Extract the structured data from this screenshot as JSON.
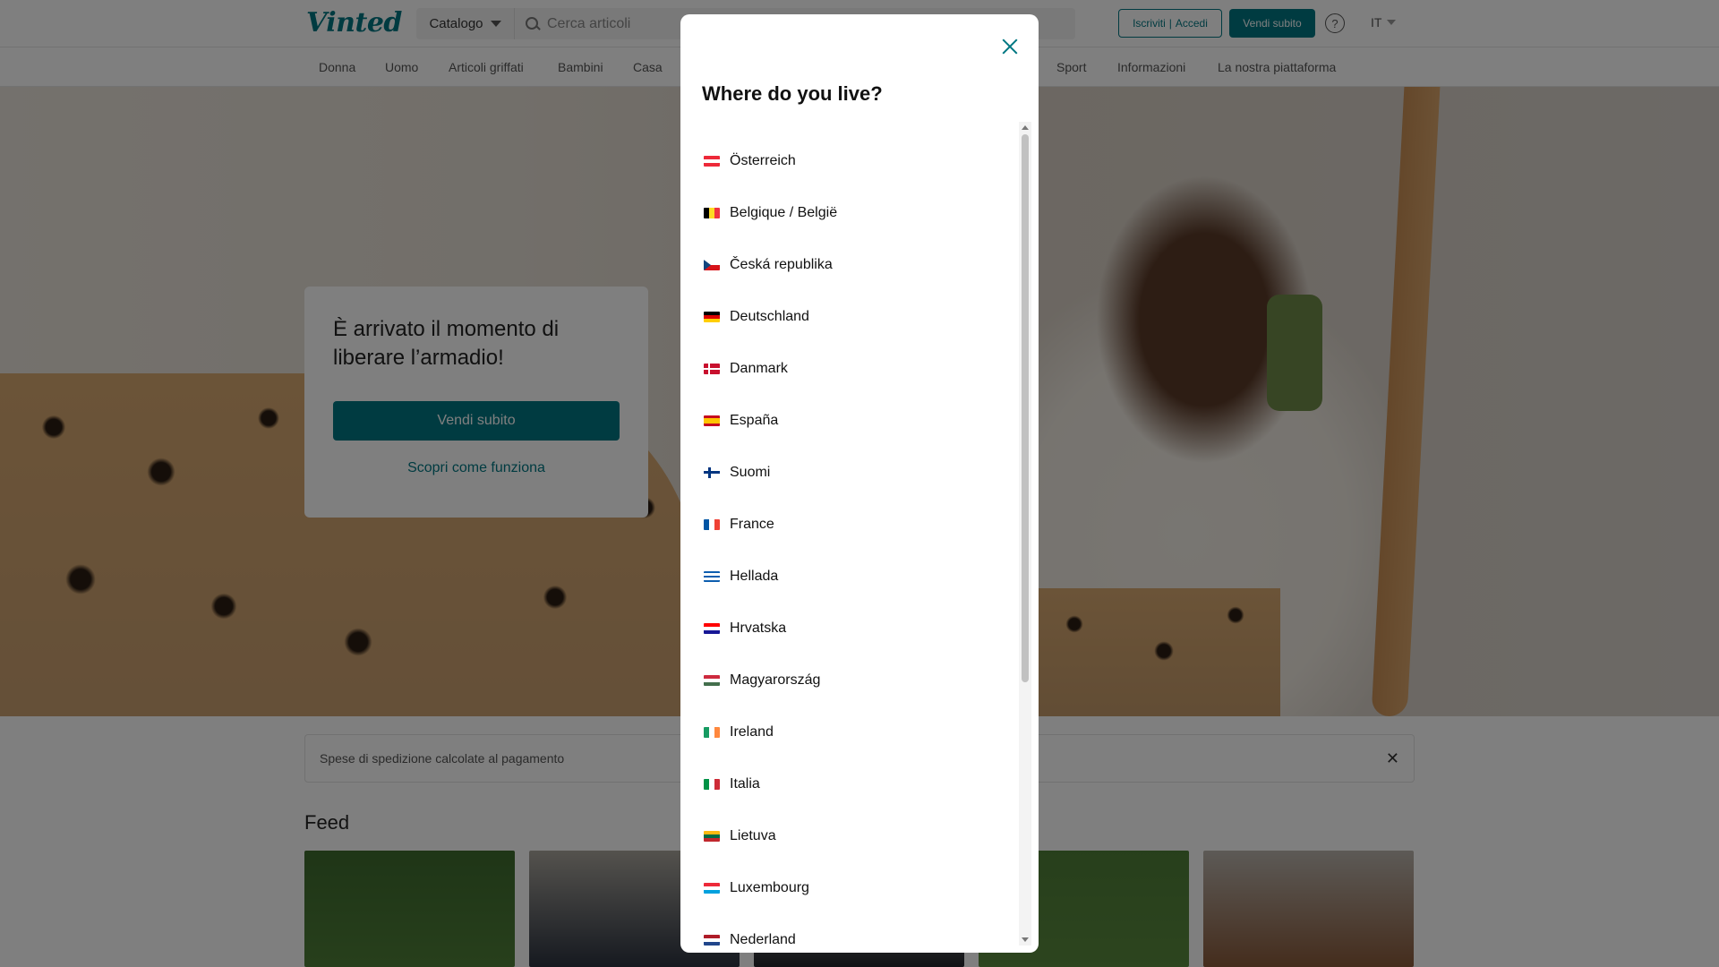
{
  "header": {
    "logo": "Vinted",
    "catalog_label": "Catalogo",
    "search_placeholder": "Cerca articoli",
    "signup_label": "Iscriviti",
    "login_label": "Accedi",
    "sell_label": "Vendi subito",
    "help_label": "?",
    "language": "IT"
  },
  "nav": {
    "items": [
      "Donna",
      "Uomo",
      "Articoli griffati",
      "Bambini",
      "Casa",
      "Sport",
      "Informazioni",
      "La nostra piattaforma"
    ]
  },
  "hero": {
    "title": "È arrivato il momento di liberare l’armadio!",
    "sell_button": "Vendi subito",
    "how_link": "Scopri come funziona"
  },
  "shipping_banner": {
    "text": "Spese di spedizione calcolate al pagamento"
  },
  "feed": {
    "title": "Feed"
  },
  "modal": {
    "title": "Where do you live?",
    "countries": [
      {
        "name": "Österreich",
        "flag": "austria-flag"
      },
      {
        "name": "Belgique / België",
        "flag": "belgium-flag"
      },
      {
        "name": "Česká republika",
        "flag": "czech-flag"
      },
      {
        "name": "Deutschland",
        "flag": "germany-flag"
      },
      {
        "name": "Danmark",
        "flag": "denmark-flag"
      },
      {
        "name": "España",
        "flag": "spain-flag"
      },
      {
        "name": "Suomi",
        "flag": "finland-flag"
      },
      {
        "name": "France",
        "flag": "france-flag"
      },
      {
        "name": "Hellada",
        "flag": "greece-flag"
      },
      {
        "name": "Hrvatska",
        "flag": "croatia-flag"
      },
      {
        "name": "Magyarország",
        "flag": "hungary-flag"
      },
      {
        "name": "Ireland",
        "flag": "ireland-flag"
      },
      {
        "name": "Italia",
        "flag": "italy-flag"
      },
      {
        "name": "Lietuva",
        "flag": "lithuania-flag"
      },
      {
        "name": "Luxembourg",
        "flag": "luxembourg-flag"
      },
      {
        "name": "Nederland",
        "flag": "netherlands-flag"
      }
    ]
  },
  "colors": {
    "brand": "#007782",
    "overlay": "rgba(0,0,0,0.5)"
  }
}
